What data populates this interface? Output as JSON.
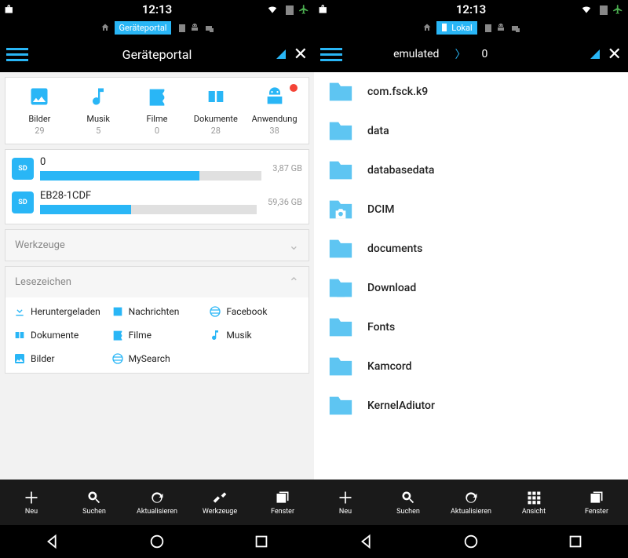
{
  "left": {
    "statusbar": {
      "time": "12:13"
    },
    "tabbar": {
      "active_label": "Geräteportal"
    },
    "header": {
      "title": "Geräteportal"
    },
    "categories": [
      {
        "label": "Bilder",
        "count": "29"
      },
      {
        "label": "Musik",
        "count": "5"
      },
      {
        "label": "Filme",
        "count": "0"
      },
      {
        "label": "Dokumente",
        "count": "28"
      },
      {
        "label": "Anwendung",
        "count": "38"
      }
    ],
    "storages": [
      {
        "name": "0",
        "total": "3,87 GB",
        "fill_pct": 72
      },
      {
        "name": "EB28-1CDF",
        "total": "59,36 GB",
        "fill_pct": 42
      }
    ],
    "tools_label": "Werkzeuge",
    "bookmarks_label": "Lesezeichen",
    "bookmarks": [
      {
        "label": "Heruntergeladen"
      },
      {
        "label": "Nachrichten"
      },
      {
        "label": "Facebook"
      },
      {
        "label": "Dokumente"
      },
      {
        "label": "Filme"
      },
      {
        "label": "Musik"
      },
      {
        "label": "Bilder"
      },
      {
        "label": "MySearch"
      }
    ],
    "bottombar": [
      {
        "label": "Neu"
      },
      {
        "label": "Suchen"
      },
      {
        "label": "Aktualisieren"
      },
      {
        "label": "Werkzeuge"
      },
      {
        "label": "Fenster"
      }
    ]
  },
  "right": {
    "statusbar": {
      "time": "12:13"
    },
    "tabbar": {
      "active_label": "Lokal"
    },
    "header": {
      "crumb1": "emulated",
      "crumb2": "0"
    },
    "folders": [
      {
        "name": "com.fsck.k9"
      },
      {
        "name": "data"
      },
      {
        "name": "databasedata"
      },
      {
        "name": "DCIM"
      },
      {
        "name": "documents"
      },
      {
        "name": "Download"
      },
      {
        "name": "Fonts"
      },
      {
        "name": "Kamcord"
      },
      {
        "name": "KernelAdiutor"
      }
    ],
    "bottombar": [
      {
        "label": "Neu"
      },
      {
        "label": "Suchen"
      },
      {
        "label": "Aktualisieren"
      },
      {
        "label": "Ansicht"
      },
      {
        "label": "Fenster"
      }
    ]
  }
}
